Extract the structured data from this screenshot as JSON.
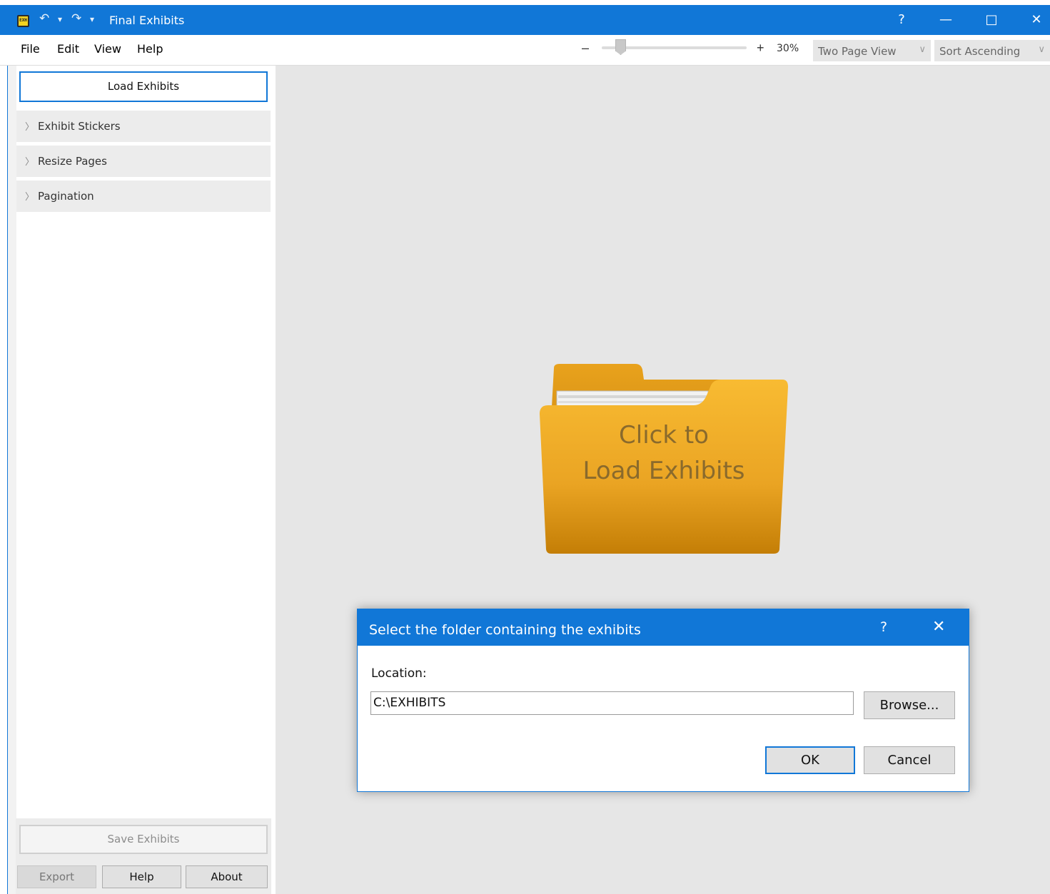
{
  "window": {
    "title": "Final Exhibits",
    "app_icon_text": "EXH",
    "help_glyph": "?",
    "minimize_glyph": "—",
    "maximize_glyph": "□",
    "close_glyph": "✕",
    "undo_glyph": "↶",
    "redo_glyph": "↷",
    "dropdown_glyph": "▾"
  },
  "menu": [
    "File",
    "Edit",
    "View",
    "Help"
  ],
  "toolbar": {
    "zoom_minus": "–",
    "zoom_plus": "+",
    "zoom_label": "30%",
    "zoom_level": 0.3,
    "view_mode": "Two Page View",
    "sort_mode": "Sort Ascending",
    "combo_chevron": "∨"
  },
  "left_panel": {
    "load_button": "Load Exhibits",
    "sections": [
      {
        "label": "Exhibit Stickers"
      },
      {
        "label": "Resize Pages"
      },
      {
        "label": "Pagination"
      }
    ],
    "section_arrow": "〉",
    "save_button": "Save Exhibits",
    "export_button": "Export",
    "help_button": "Help",
    "about_button": "About"
  },
  "main": {
    "placeholder_line1": "Click to",
    "placeholder_line2": "Load Exhibits"
  },
  "dialog": {
    "title": "Select the folder containing the exhibits",
    "help_glyph": "?",
    "close_glyph": "✕",
    "location_label": "Location:",
    "location_value": "C:\\EXHIBITS",
    "browse_button": "Browse...",
    "ok_button": "OK",
    "cancel_button": "Cancel"
  },
  "colors": {
    "accent": "#1177d7",
    "folder_top": "#f7b52a",
    "folder_bottom": "#c47e06"
  }
}
